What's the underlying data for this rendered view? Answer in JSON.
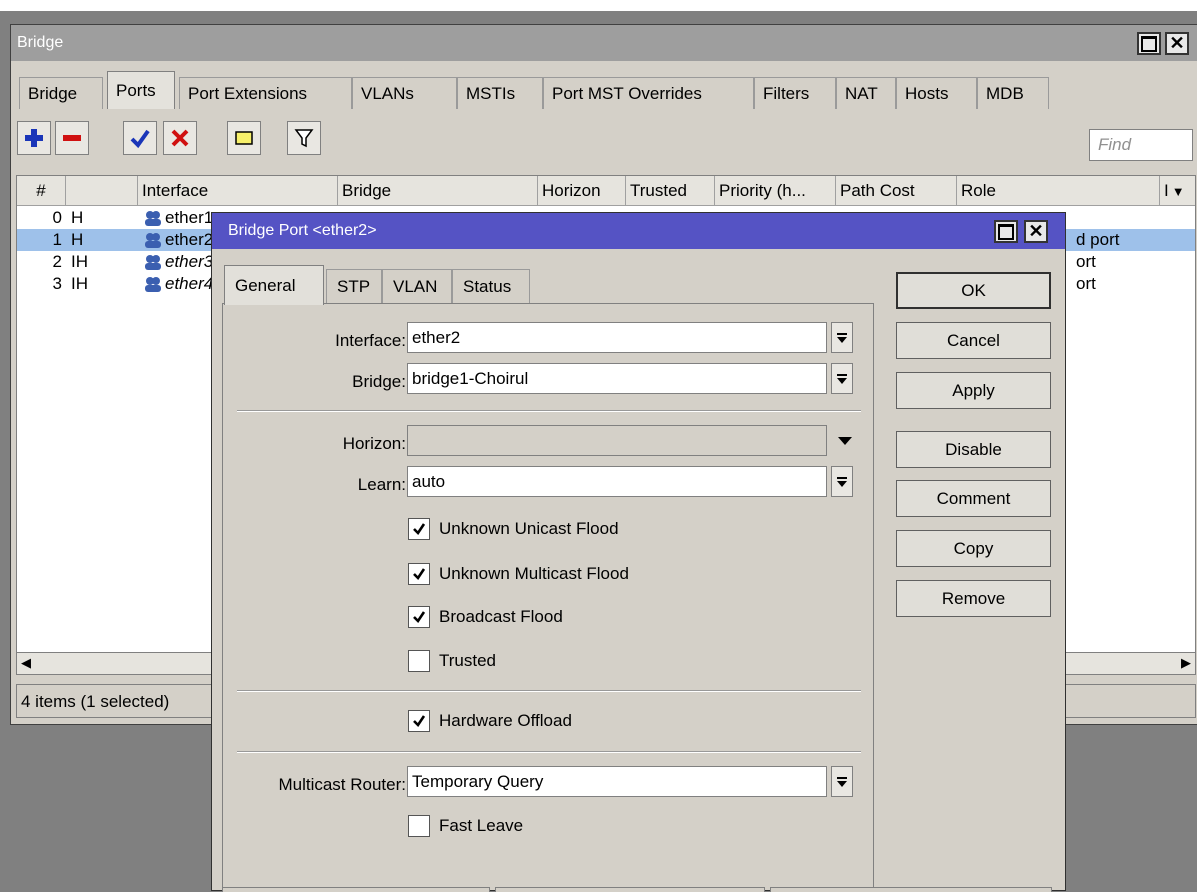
{
  "window": {
    "title": "Bridge",
    "tabs": [
      "Bridge",
      "Ports",
      "Port Extensions",
      "VLANs",
      "MSTIs",
      "Port MST Overrides",
      "Filters",
      "NAT",
      "Hosts",
      "MDB"
    ],
    "find_placeholder": "Find",
    "columns": [
      "#",
      "",
      "Interface",
      "Bridge",
      "Horizon",
      "Trusted",
      "Priority (h...",
      "Path Cost",
      "Role",
      "I"
    ],
    "rows": [
      {
        "num": "0",
        "flag": "H",
        "iface": "ether1",
        "role": ""
      },
      {
        "num": "1",
        "flag": "H",
        "iface": "ether2",
        "role": "d port"
      },
      {
        "num": "2",
        "flag": "IH",
        "iface": "ether3",
        "role": "ort"
      },
      {
        "num": "3",
        "flag": "IH",
        "iface": "ether4",
        "role": "ort"
      }
    ],
    "status": "4 items (1 selected)"
  },
  "dialog": {
    "title": "Bridge Port <ether2>",
    "tabs": [
      "General",
      "STP",
      "VLAN",
      "Status"
    ],
    "fields": {
      "interface_label": "Interface:",
      "interface_value": "ether2",
      "bridge_label": "Bridge:",
      "bridge_value": "bridge1-Choirul",
      "horizon_label": "Horizon:",
      "horizon_value": "",
      "learn_label": "Learn:",
      "learn_value": "auto",
      "mcast_router_label": "Multicast Router:",
      "mcast_router_value": "Temporary Query"
    },
    "checkboxes": {
      "unknown_unicast": "Unknown Unicast Flood",
      "unknown_multicast": "Unknown Multicast Flood",
      "broadcast": "Broadcast Flood",
      "trusted": "Trusted",
      "hw_offload": "Hardware Offload",
      "fast_leave": "Fast Leave"
    },
    "buttons": [
      "OK",
      "Cancel",
      "Apply",
      "Disable",
      "Comment",
      "Copy",
      "Remove"
    ]
  },
  "colors": {
    "dialog_title_bar": "#5553c4",
    "selected_row": "#9ec1ea",
    "window_title_bar": "#9e9e9e"
  }
}
